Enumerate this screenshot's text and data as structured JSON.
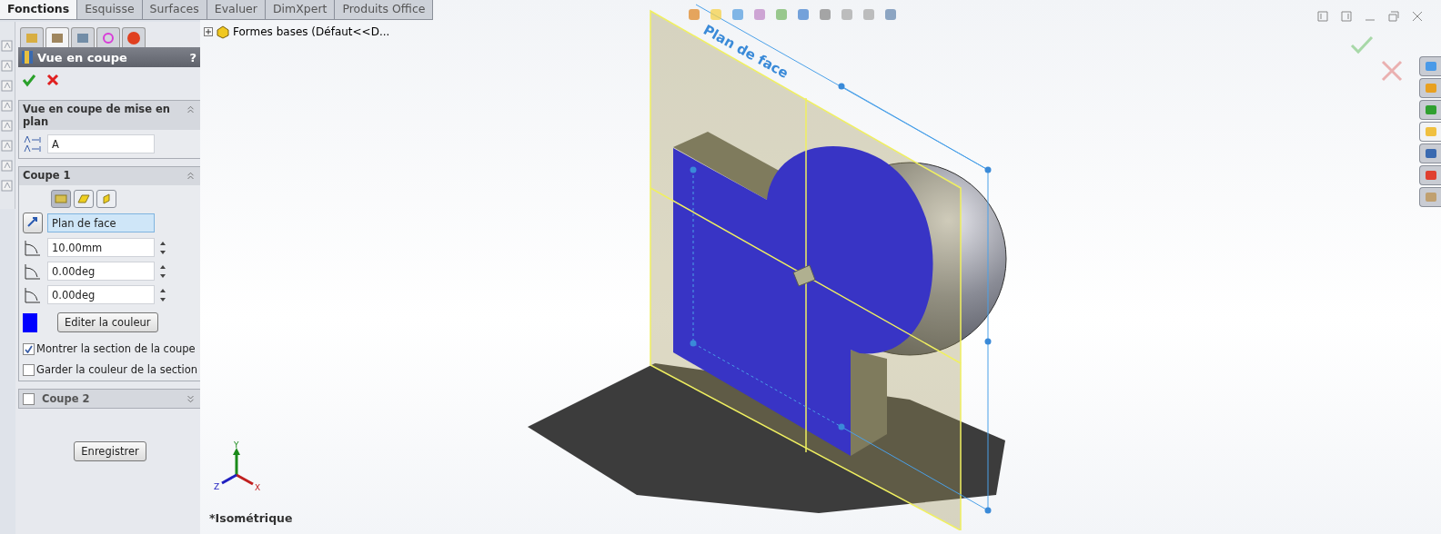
{
  "tabs": [
    {
      "label": "Fonctions",
      "selected": true
    },
    {
      "label": "Esquisse",
      "selected": false
    },
    {
      "label": "Surfaces",
      "selected": false
    },
    {
      "label": "Evaluer",
      "selected": false
    },
    {
      "label": "DimXpert",
      "selected": false
    },
    {
      "label": "Produits Office",
      "selected": false
    }
  ],
  "panel": {
    "tabs": [
      {
        "selected": false
      },
      {
        "selected": true
      },
      {
        "selected": false
      },
      {
        "selected": false
      },
      {
        "selected": false
      }
    ],
    "title": "Vue en coupe",
    "help": "?",
    "section_view": {
      "title": "Vue en coupe de mise en plan",
      "label_value": "A"
    },
    "cut_1": {
      "title": "Coupe 1",
      "plane_buttons": [
        {
          "selected": true
        },
        {
          "selected": false
        },
        {
          "selected": false
        }
      ],
      "plane": "Plan de face",
      "distance": "10.00mm",
      "angle_x": "0.00deg",
      "angle_y": "0.00deg",
      "color": "#0000ff",
      "edit_color_button": "Editer la couleur",
      "options": [
        {
          "label": "Montrer la section de la coupe",
          "checked": true
        },
        {
          "label": "Garder la couleur de la section",
          "checked": false
        }
      ]
    },
    "cut_2": {
      "title": "Coupe 2",
      "checked": false
    },
    "save_button": "Enregistrer"
  },
  "tree": {
    "root": "Formes bases  (Défaut<<D..."
  },
  "viewport": {
    "task_pane": [
      {
        "selected": false
      },
      {
        "selected": false
      },
      {
        "selected": false
      },
      {
        "selected": true
      },
      {
        "selected": false
      },
      {
        "selected": false
      },
      {
        "selected": false
      }
    ],
    "plane_label": "Plan de face",
    "triad": {
      "x": "X",
      "y": "Y",
      "z": "Z"
    },
    "view_name": "*Isométrique"
  }
}
